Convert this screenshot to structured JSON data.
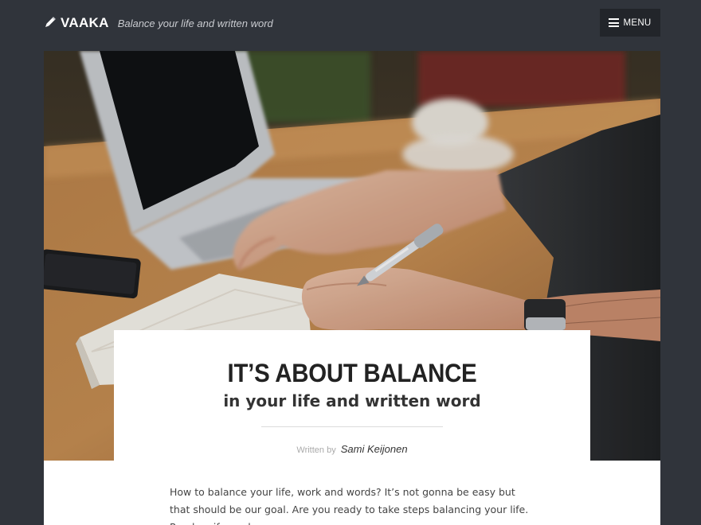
{
  "header": {
    "site_title": "VAAKA",
    "tagline": "Balance your life and written word",
    "menu_label": "MENU",
    "icons": [
      "pencil-icon",
      "hamburger-icon"
    ]
  },
  "hero": {
    "image": "person-writing-in-notebook-beside-laptop-photo"
  },
  "post": {
    "title": "IT’S ABOUT BALANCE",
    "subtitle": "in your life and written word",
    "byline_prefix": "Written by",
    "author": "Sami Keijonen",
    "intro": "How to balance your life, work and words? It’s not gonna be easy but that should be our goal. Are you ready to take steps balancing your life. Read on if you do."
  },
  "colors": {
    "background": "#30343b",
    "menu_button": "#22252a",
    "card": "#ffffff"
  }
}
